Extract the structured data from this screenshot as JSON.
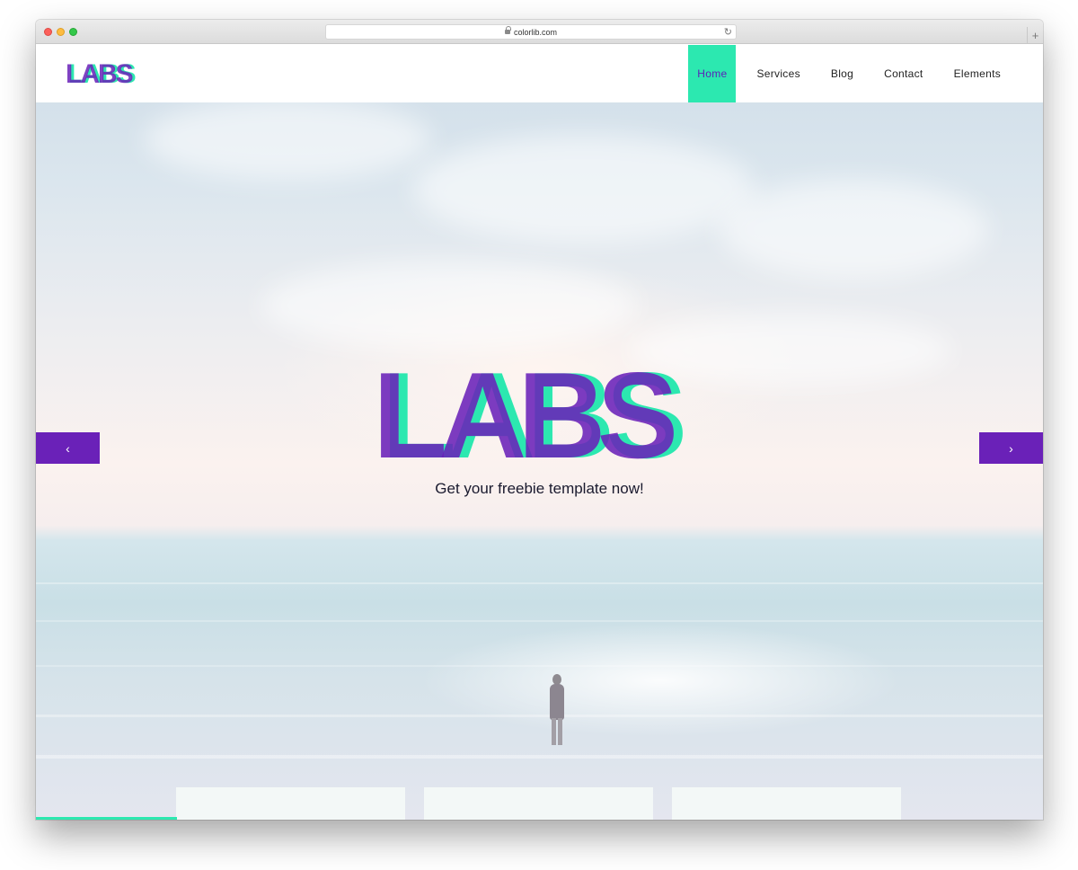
{
  "browser": {
    "url": "colorlib.com",
    "reload_icon": "reload-icon",
    "newtab_icon": "plus-icon"
  },
  "site": {
    "logo_text": "LABS",
    "nav": [
      {
        "label": "Home",
        "active": true
      },
      {
        "label": "Services",
        "active": false
      },
      {
        "label": "Blog",
        "active": false
      },
      {
        "label": "Contact",
        "active": false
      },
      {
        "label": "Elements",
        "active": false
      }
    ],
    "hero": {
      "title": "LABS",
      "tagline": "Get your freebie template now!",
      "prev_icon": "chevron-left-icon",
      "next_icon": "chevron-right-icon",
      "slide_progress": 0.14
    },
    "colors": {
      "accent_green": "#2ce8b0",
      "accent_purple": "#6a21b8",
      "dark_overlap": "#2e2470"
    }
  }
}
